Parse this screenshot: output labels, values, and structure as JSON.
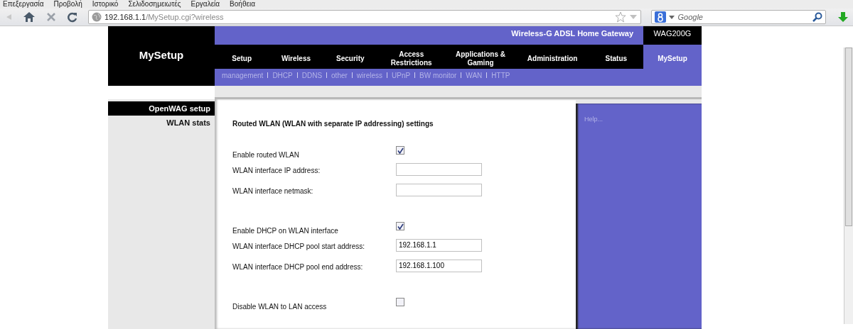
{
  "browser": {
    "menu": [
      "Επεξεργασία",
      "Προβολή",
      "Ιστορικό",
      "Σελιδοσημειωτές",
      "Εργαλεία",
      "Βοήθεια"
    ],
    "address": {
      "host": "192.168.1.1",
      "path": "/MySetup.cgi?wireless"
    },
    "search": {
      "placeholder": "Google"
    }
  },
  "header": {
    "title": "MySetup",
    "product": "Wireless-G ADSL Home Gateway",
    "model": "WAG200G"
  },
  "tabs": [
    {
      "label": "Setup",
      "selected": false
    },
    {
      "label": "Wireless",
      "selected": false
    },
    {
      "label": "Security",
      "selected": false
    },
    {
      "label": "Access Restrictions",
      "selected": false
    },
    {
      "label": "Applications & Gaming",
      "selected": false
    },
    {
      "label": "Administration",
      "selected": false
    },
    {
      "label": "Status",
      "selected": false
    },
    {
      "label": "MySetup",
      "selected": true
    }
  ],
  "subtabs": [
    "management",
    "DHCP",
    "DDNS",
    "other",
    "wireless",
    "UPnP",
    "BW monitor",
    "WAN",
    "HTTP"
  ],
  "sidebar": {
    "items": [
      {
        "label": "OpenWAG setup",
        "selected": true
      },
      {
        "label": "WLAN stats",
        "selected": false
      }
    ]
  },
  "form": {
    "heading": "Routed WLAN (WLAN with separate IP addressing) settings",
    "rows": [
      {
        "kind": "checkbox",
        "label": "Enable routed WLAN",
        "checked": true
      },
      {
        "kind": "input",
        "label": "WLAN interface IP address:"
      },
      {
        "kind": "input",
        "label": "WLAN interface netmask:"
      },
      {
        "kind": "spacer"
      },
      {
        "kind": "checkbox",
        "label": "Enable DHCP on WLAN interface",
        "checked": true
      },
      {
        "kind": "input",
        "label": "WLAN interface DHCP pool start address:",
        "value": "192.168.1.1"
      },
      {
        "kind": "input",
        "label": "WLAN interface DHCP pool end address:",
        "value": "192.168.1.100"
      },
      {
        "kind": "spacer"
      },
      {
        "kind": "checkbox",
        "label": "Disable WLAN to LAN access",
        "checked": false
      }
    ]
  },
  "help": {
    "text": "Help..."
  }
}
